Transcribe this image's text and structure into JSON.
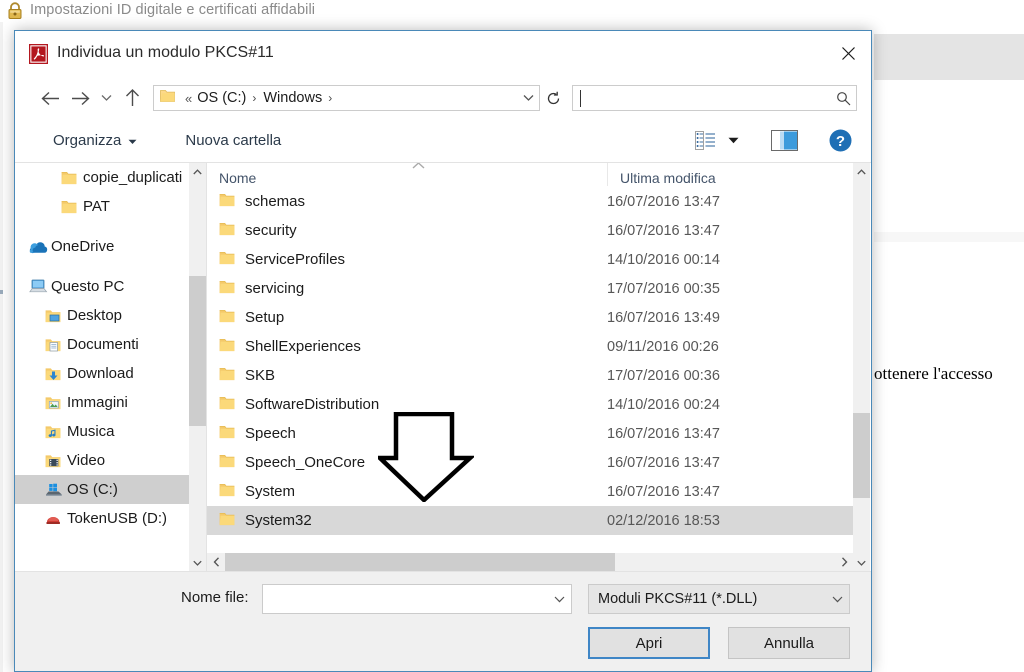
{
  "background": {
    "title": "Impostazioni ID digitale e certificati affidabili",
    "lock_icon": "padlock-icon",
    "body_text": "ottenere l'accesso"
  },
  "dialog": {
    "title": "Individua un modulo PKCS#11",
    "icon": "adobe-acrobat-icon",
    "close_label": "×"
  },
  "nav": {
    "back_icon": "arrow-left-icon",
    "forward_icon": "arrow-right-icon",
    "recent_icon": "chevron-down-icon",
    "up_icon": "arrow-up-icon",
    "breadcrumb_prefix": "«",
    "breadcrumb": [
      "OS (C:)",
      "Windows"
    ],
    "address_dropdown_icon": "chevron-down-icon",
    "refresh_icon": "refresh-icon",
    "search_value": "",
    "search_placeholder": "",
    "search_icon": "search-icon"
  },
  "toolbar": {
    "organizza_label": "Organizza",
    "organizza_caret_icon": "caret-down-icon",
    "nuova_cartella_label": "Nuova cartella",
    "view_icon": "view-list-icon",
    "view_caret_icon": "caret-down-icon",
    "preview_pane_icon": "preview-pane-icon",
    "help_icon": "help-circle-icon"
  },
  "sidebar": {
    "items": [
      {
        "label": "copie_duplicati",
        "icon": "folder-icon",
        "indent": 2,
        "selected": false,
        "gap": false
      },
      {
        "label": "PAT",
        "icon": "folder-icon",
        "indent": 2,
        "selected": false,
        "gap": false
      },
      {
        "label": "OneDrive",
        "icon": "onedrive-icon",
        "indent": 0,
        "selected": false,
        "gap": true
      },
      {
        "label": "Questo PC",
        "icon": "this-pc-icon",
        "indent": 0,
        "selected": false,
        "gap": true
      },
      {
        "label": "Desktop",
        "icon": "desktop-folder-icon",
        "indent": 1,
        "selected": false,
        "gap": false
      },
      {
        "label": "Documenti",
        "icon": "documents-folder-icon",
        "indent": 1,
        "selected": false,
        "gap": false
      },
      {
        "label": "Download",
        "icon": "downloads-folder-icon",
        "indent": 1,
        "selected": false,
        "gap": false
      },
      {
        "label": "Immagini",
        "icon": "pictures-folder-icon",
        "indent": 1,
        "selected": false,
        "gap": false
      },
      {
        "label": "Musica",
        "icon": "music-folder-icon",
        "indent": 1,
        "selected": false,
        "gap": false
      },
      {
        "label": "Video",
        "icon": "video-folder-icon",
        "indent": 1,
        "selected": false,
        "gap": false
      },
      {
        "label": "OS (C:)",
        "icon": "windows-drive-icon",
        "indent": 1,
        "selected": true,
        "gap": false
      },
      {
        "label": "TokenUSB (D:)",
        "icon": "usb-drive-icon",
        "indent": 1,
        "selected": false,
        "gap": false
      }
    ],
    "scroll_up_icon": "chevron-up-icon",
    "scroll_down_icon": "chevron-down-icon"
  },
  "filelist": {
    "columns": [
      "Nome",
      "Ultima modifica"
    ],
    "sort_icon": "sort-ascending-icon",
    "rows": [
      {
        "name": "schemas",
        "modified": "16/07/2016 13:47",
        "icon": "folder-icon",
        "selected": false
      },
      {
        "name": "security",
        "modified": "16/07/2016 13:47",
        "icon": "folder-icon",
        "selected": false
      },
      {
        "name": "ServiceProfiles",
        "modified": "14/10/2016 00:14",
        "icon": "folder-icon",
        "selected": false
      },
      {
        "name": "servicing",
        "modified": "17/07/2016 00:35",
        "icon": "folder-icon",
        "selected": false
      },
      {
        "name": "Setup",
        "modified": "16/07/2016 13:49",
        "icon": "folder-icon",
        "selected": false
      },
      {
        "name": "ShellExperiences",
        "modified": "09/11/2016 00:26",
        "icon": "folder-icon",
        "selected": false
      },
      {
        "name": "SKB",
        "modified": "17/07/2016 00:36",
        "icon": "folder-icon",
        "selected": false
      },
      {
        "name": "SoftwareDistribution",
        "modified": "14/10/2016 00:24",
        "icon": "folder-icon",
        "selected": false
      },
      {
        "name": "Speech",
        "modified": "16/07/2016 13:47",
        "icon": "folder-icon",
        "selected": false
      },
      {
        "name": "Speech_OneCore",
        "modified": "16/07/2016 13:47",
        "icon": "folder-icon",
        "selected": false
      },
      {
        "name": "System",
        "modified": "16/07/2016 13:47",
        "icon": "folder-icon",
        "selected": false
      },
      {
        "name": "System32",
        "modified": "02/12/2016 18:53",
        "icon": "folder-icon",
        "selected": true
      }
    ],
    "vscroll_up_icon": "chevron-up-icon",
    "vscroll_down_icon": "chevron-down-icon",
    "hscroll_left_icon": "chevron-left-icon",
    "hscroll_right_icon": "chevron-right-icon"
  },
  "footer": {
    "filename_label": "Nome file:",
    "filename_value": "",
    "filename_dropdown_icon": "chevron-down-icon",
    "filter_value": "Moduli PKCS#11 (*.DLL)",
    "filter_dropdown_icon": "chevron-down-icon",
    "open_button": "Apri",
    "cancel_button": "Annulla"
  },
  "annotation": {
    "arrow_icon": "down-arrow-annotation"
  },
  "colors": {
    "dialog_border": "#4a89b8",
    "accent_button_border": "#3f86c6",
    "selection": "#d8d8d8",
    "folder_yellow": "#fbd97a",
    "header_text": "#44546a"
  }
}
